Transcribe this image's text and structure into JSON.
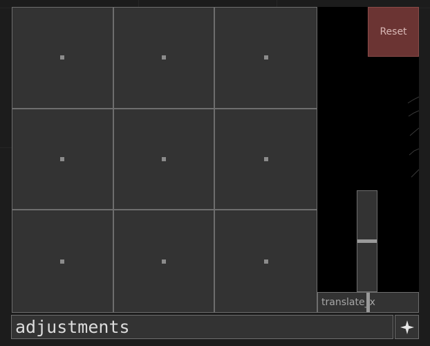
{
  "grid": {
    "cells": [
      {
        "id": "top-left"
      },
      {
        "id": "top-center"
      },
      {
        "id": "top-right"
      },
      {
        "id": "middle-left"
      },
      {
        "id": "center"
      },
      {
        "id": "middle-right"
      },
      {
        "id": "bottom-left"
      },
      {
        "id": "bottom-center"
      },
      {
        "id": "bottom-right"
      }
    ]
  },
  "panel": {
    "reset_label": "Reset",
    "vertical_slider": {
      "value_fraction": 0.5
    },
    "horizontal_slider": {
      "label": "translate_x",
      "value_fraction": 0.5
    }
  },
  "command": {
    "value": "adjustments",
    "submit_icon": "four-point-star-icon"
  },
  "colors": {
    "reset_accent": "#6b3433",
    "cell_background": "#333333",
    "panel_background": "#000000"
  }
}
